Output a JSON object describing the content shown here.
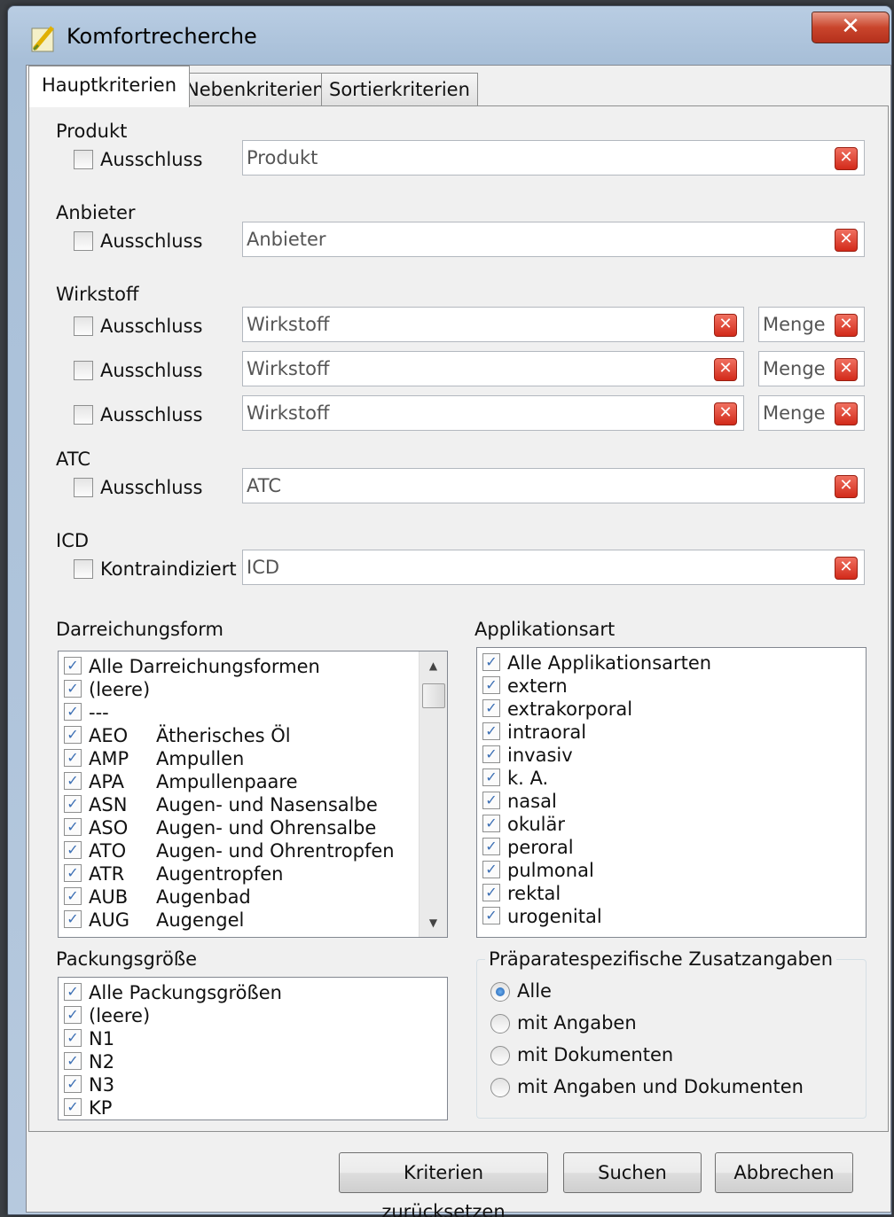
{
  "window": {
    "title": "Komfortrecherche",
    "close_glyph": "✕"
  },
  "tabs": [
    "Hauptkriterien",
    "Nebenkriterien",
    "Sortierkriterien"
  ],
  "fields": {
    "produkt": {
      "label": "Produkt",
      "checkbox": "Ausschluss",
      "placeholder": "Produkt"
    },
    "anbieter": {
      "label": "Anbieter",
      "checkbox": "Ausschluss",
      "placeholder": "Anbieter"
    },
    "wirkstoff": {
      "label": "Wirkstoff",
      "rows": [
        {
          "checkbox": "Ausschluss",
          "placeholder": "Wirkstoff",
          "menge": "Menge"
        },
        {
          "checkbox": "Ausschluss",
          "placeholder": "Wirkstoff",
          "menge": "Menge"
        },
        {
          "checkbox": "Ausschluss",
          "placeholder": "Wirkstoff",
          "menge": "Menge"
        }
      ]
    },
    "atc": {
      "label": "ATC",
      "checkbox": "Ausschluss",
      "placeholder": "ATC"
    },
    "icd": {
      "label": "ICD",
      "checkbox": "Kontraindiziert",
      "placeholder": "ICD"
    }
  },
  "darreichungsform": {
    "label": "Darreichungsform",
    "items": [
      {
        "code": "Alle Darreichungsformen",
        "desc": ""
      },
      {
        "code": "(leere)",
        "desc": ""
      },
      {
        "code": "---",
        "desc": ""
      },
      {
        "code": "AEO",
        "desc": "Ätherisches Öl"
      },
      {
        "code": "AMP",
        "desc": "Ampullen"
      },
      {
        "code": "APA",
        "desc": "Ampullenpaare"
      },
      {
        "code": "ASN",
        "desc": "Augen- und Nasensalbe"
      },
      {
        "code": "ASO",
        "desc": "Augen- und Ohrensalbe"
      },
      {
        "code": "ATO",
        "desc": "Augen- und Ohrentropfen"
      },
      {
        "code": "ATR",
        "desc": "Augentropfen"
      },
      {
        "code": "AUB",
        "desc": "Augenbad"
      },
      {
        "code": "AUG",
        "desc": "Augengel"
      }
    ]
  },
  "applikationsart": {
    "label": "Applikationsart",
    "items": [
      "Alle Applikationsarten",
      "extern",
      "extrakorporal",
      "intraoral",
      "invasiv",
      "k. A.",
      "nasal",
      "okulär",
      "peroral",
      "pulmonal",
      "rektal",
      "urogenital"
    ]
  },
  "packungsgroesse": {
    "label": "Packungsgröße",
    "items": [
      "Alle Packungsgrößen",
      "(leere)",
      "N1",
      "N2",
      "N3",
      "KP"
    ]
  },
  "zusatzangaben": {
    "label": "Präparatespezifische Zusatzangaben",
    "options": [
      "Alle",
      "mit Angaben",
      "mit Dokumenten",
      "mit Angaben und Dokumenten"
    ],
    "selected": "Alle"
  },
  "buttons": {
    "reset": "Kriterien zurücksetzen",
    "search": "Suchen",
    "cancel": "Abbrechen"
  },
  "icons": {
    "clear": "✕",
    "check": "✓",
    "scroll_up": "▲",
    "scroll_down": "▼"
  }
}
